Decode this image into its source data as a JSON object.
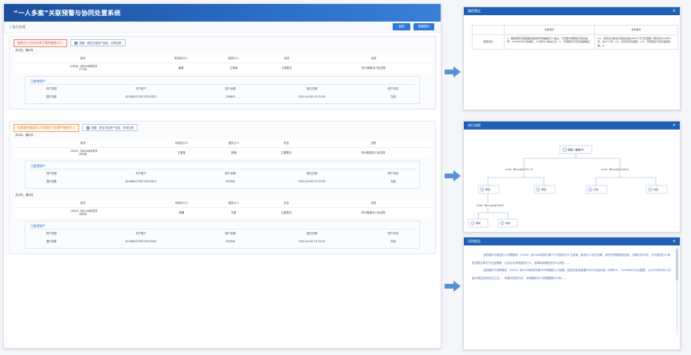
{
  "app": {
    "title": "“一人多案”关联预警与协同处置系统"
  },
  "toolbar": {
    "breadcrumb": "| 执行处理",
    "btn1": "返回",
    "btn2": "措施提示"
  },
  "section1": {
    "warning": "被执行人员存在多于案件被执行人",
    "hint": "提醒：属性冻结财产信息、协同处置",
    "groups": [
      {
        "label": "共1件，第1件",
        "headers": [
          "案号",
          "申请执行人",
          "被执行人",
          "状态",
          "法院"
        ],
        "row": [
          "（2020）浙0106执恢字\n777号",
          "姜某",
          "王某某",
          "立案登记",
          "杭州某某法人民法院"
        ],
        "property": {
          "title": "已查控财产",
          "headers": [
            "财产类型",
            "开户账户",
            "账户余额",
            "登记日期",
            "财产状态"
          ],
          "row": [
            "银行存款",
            "6216820730017815813",
            "208800",
            "2020-04-08 13:35:00",
            "冻结"
          ]
        }
      }
    ]
  },
  "section2": {
    "warning": "此案前申请执行人同属多于存案件被执行人",
    "hint": "提醒：属性冻结财产信息、协同处置",
    "groups": [
      {
        "label": "共2件，第1件",
        "headers": [
          "案号",
          "申请执行人",
          "被执行人",
          "状态",
          "法院"
        ],
        "row": [
          "（2020）浙0106执恢字\n999号",
          "王某某",
          "张楠",
          "立案登记",
          "杭州某某法人民法院"
        ],
        "property": {
          "title": "已查控财产",
          "headers": [
            "财产类型",
            "开户账户",
            "账户余额",
            "登记日期",
            "财产状态"
          ],
          "row": [
            "银行存款",
            "6216820730017815813",
            "303000",
            "2020-04-08 13:35:00",
            "冻结"
          ]
        }
      },
      {
        "label": "共2件，第2件",
        "headers": [
          "案号",
          "申请执行人",
          "被执行人",
          "状态",
          "法院"
        ],
        "row": [
          "（2020）浙0106执恢字\n888号",
          "张楠",
          "刘某",
          "立案登记",
          "杭州某某法人民法院"
        ],
        "property": {
          "title": "已查控财产",
          "headers": [
            "财产类型",
            "开户账户",
            "账户余额",
            "登记日期",
            "财产状态"
          ],
          "row": [
            "银行存款",
            "6216820730017815000",
            "303000",
            "2020-04-08 13:35:00",
            "冻结"
          ]
        }
      }
    ]
  },
  "summary_panel": {
    "title": "路径建议",
    "col_headers": [
      "",
      "协助事件",
      "协助事件"
    ],
    "row_label": "路径建议",
    "cell1": "1、要案审查法院根据关联案件查询被执行人信息，不足部分按照执行案件编号，12000000元未偿还，\\n2执行公告在之日，2、不能保证与实际金额相合。",
    "cell2": "\\n1、因涉及关联执行案情况金603077万元及到期（暂时至2020年4月，共27个月）\\n2、因涉及利息偿还，\\n3、不能保证与实际金额合相，\\n"
  },
  "flow_panel": {
    "title": "执行流程",
    "root": "张楠（被执行）",
    "level1": [
      "（2020）浙0106执恢字777号",
      "（2020）浙0106执恢字999号"
    ],
    "level2": [
      "李某",
      "吴某",
      "王某",
      "刘某"
    ],
    "level3": [
      "（2020）浙0106执恢字888号"
    ],
    "level4": [
      "徐某",
      "张某"
    ]
  },
  "risk_panel": {
    "title": "风险报告",
    "paragraphs": [
      "当前案件与被执行人关联案件（2020）浙0106执恢字第777号被执行人王某某，被执行人存在关联，判决书所载明的信息，未履行的义务，不与被执行人承担关联法律文书已经按照，公告后与其他被执行人，张楠将到期债权予以冻结……",
      "当前案件与关联案件（2020）浙0106执恢字第999号被执行人张楠，因涉及查询金额50000元及利息（利率4%，22500000元为基数，从2018年4月10日起计算至实际给付之日），本案仍在执行中，本案被执行人须按期履行义务……"
    ]
  },
  "colors": {
    "header": "#1b4f9c",
    "accent": "#2f7ad8",
    "warn": "#d9534f",
    "orange": "#e07a1f"
  }
}
